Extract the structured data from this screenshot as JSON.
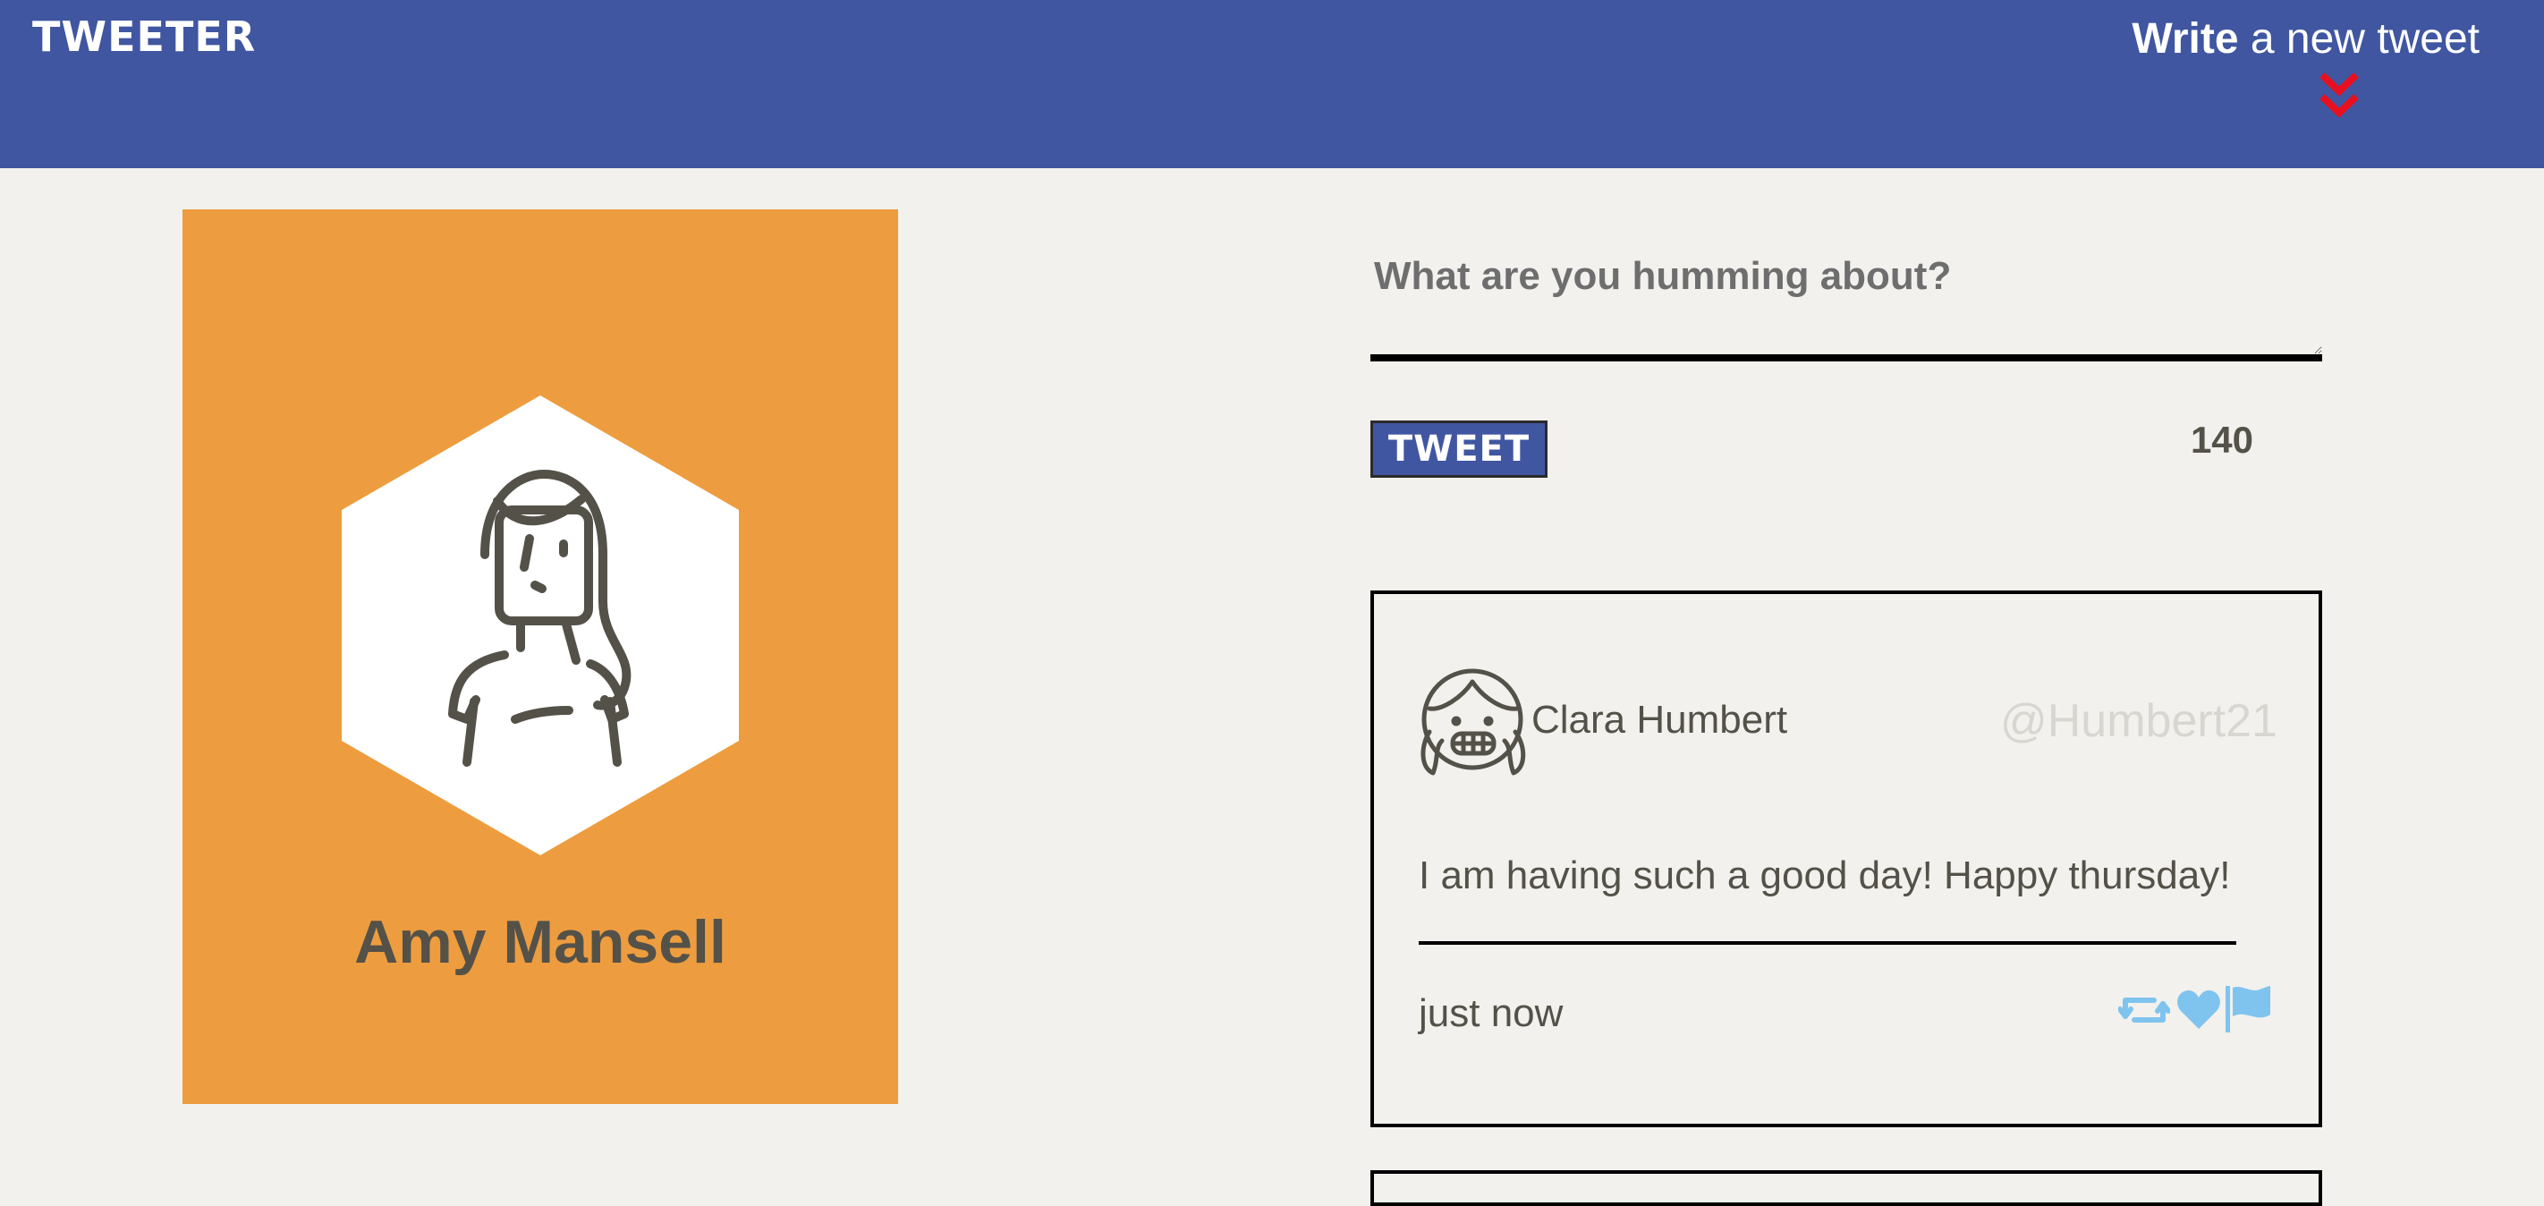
{
  "nav": {
    "logo": "TWEETER",
    "compose_bold": "Write",
    "compose_rest": " a new tweet",
    "chevron_icon": "double-chevron-down-icon",
    "bg_color": "#4056a1",
    "chevron_color": "#e8101f"
  },
  "profile": {
    "name": "Amy Mansell",
    "avatar_icon": "woman-avatar-icon",
    "card_color": "#ed9d3f"
  },
  "composer": {
    "placeholder": "What are you humming about?",
    "button_label": "TWEET",
    "char_count": "140"
  },
  "tweets": [
    {
      "author_name": "Clara Humbert",
      "handle": "@Humbert21",
      "avatar_icon": "girl-avatar-icon",
      "text": "I am having such a good day! Happy thursday!",
      "timestamp": "just now",
      "actions": [
        "retweet-icon",
        "heart-icon",
        "flag-icon"
      ],
      "action_color": "#7fc4ef"
    }
  ]
}
